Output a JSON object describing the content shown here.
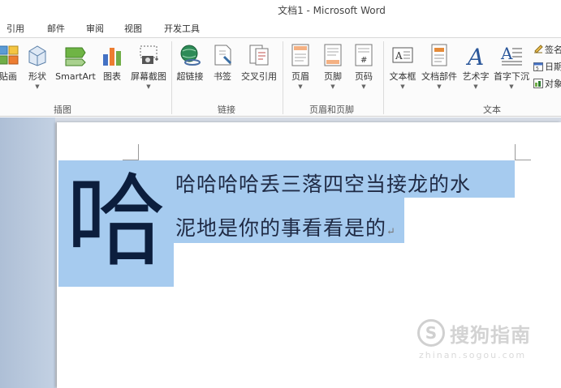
{
  "window": {
    "title": "文档1 - Microsoft Word"
  },
  "tabs": [
    "引用",
    "邮件",
    "审阅",
    "视图",
    "开发工具"
  ],
  "ribbon": {
    "groups": {
      "illustrations": {
        "label": "插图",
        "buttons": [
          "贴画",
          "形状",
          "SmartArt",
          "图表",
          "屏幕截图"
        ]
      },
      "links": {
        "label": "链接",
        "buttons": [
          "超链接",
          "书签",
          "交叉引用"
        ]
      },
      "header_footer": {
        "label": "页眉和页脚",
        "buttons": [
          "页眉",
          "页脚",
          "页码"
        ]
      },
      "text": {
        "label": "文本",
        "buttons": [
          "文本框",
          "文档部件",
          "艺术字",
          "首字下沉"
        ]
      }
    },
    "side_buttons": [
      "签名",
      "日期",
      "对象"
    ]
  },
  "document": {
    "drop_cap": "哈",
    "lines": [
      "哈哈哈哈丢三落四空当接龙的水",
      "泥地是你的事看看是的"
    ],
    "paragraph_mark": "↵"
  },
  "watermark": {
    "symbol": "S",
    "text": "搜狗指南",
    "sub": "zhinan.sogou.com"
  },
  "colors": {
    "selection": "#a6cbef",
    "word_blue": "#2b579a",
    "navigation_pane": "#b8c8dd"
  }
}
